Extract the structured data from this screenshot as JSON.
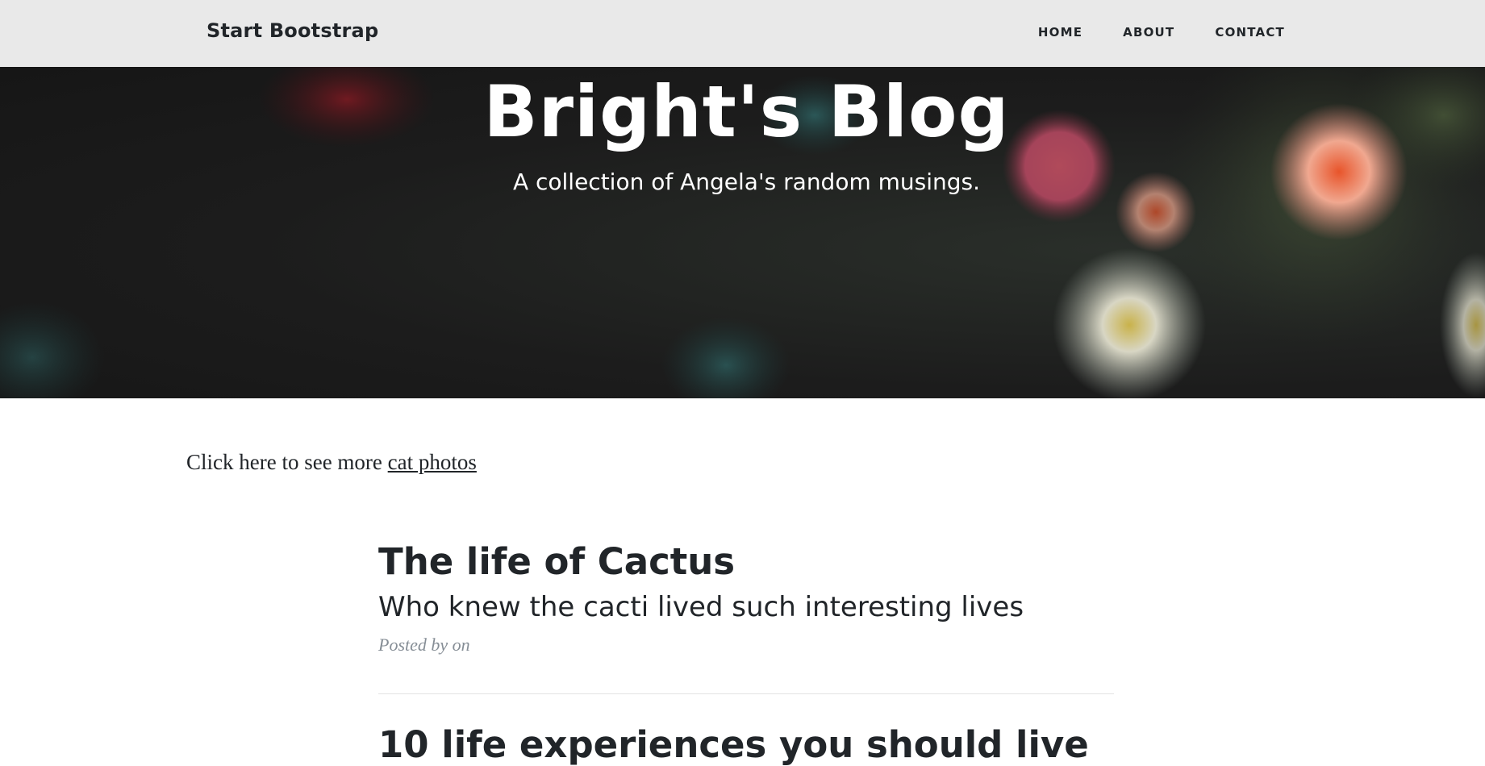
{
  "navbar": {
    "brand": "Start Bootstrap",
    "links": [
      "HOME",
      "ABOUT",
      "CONTACT"
    ],
    "background": "#e9e9e9"
  },
  "hero": {
    "title": "Bright's Blog",
    "subtitle": "A collection of Angela's random musings."
  },
  "intro": {
    "text": "Click here to see more ",
    "link_text": "cat photos"
  },
  "posts": [
    {
      "title": "The life of Cactus",
      "subtitle": "Who knew the cacti lived such interesting lives",
      "meta": "Posted by on"
    },
    {
      "title": "10 life experiences you should live"
    }
  ],
  "colors": {
    "text": "#212529",
    "meta": "#868e96",
    "divider": "#e3e3e3"
  }
}
